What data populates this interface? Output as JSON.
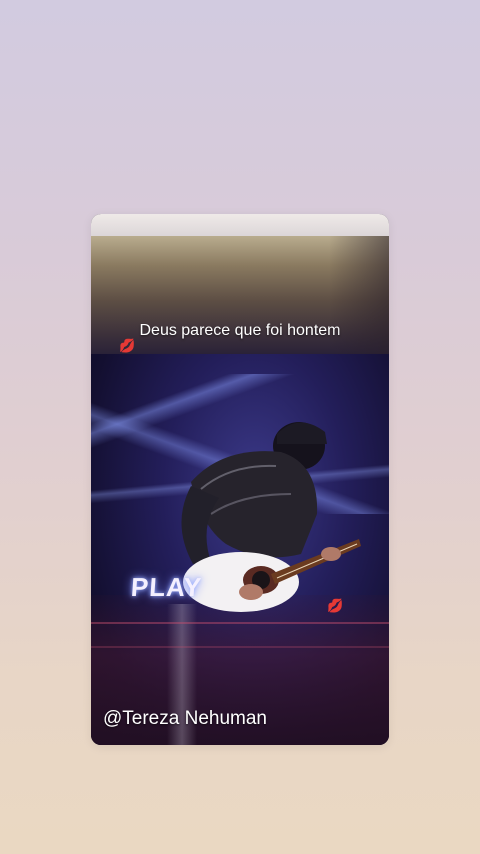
{
  "story": {
    "caption": "Deus parece que foi hontem",
    "overlay_label": "PLAY",
    "author_handle": "@Tereza Nehuman",
    "sticker_icon": "lips-kiss-icon"
  },
  "colors": {
    "caption_text": "#ffffff",
    "sticker": "#e0203a",
    "play_glow": "#9fb2ff"
  }
}
